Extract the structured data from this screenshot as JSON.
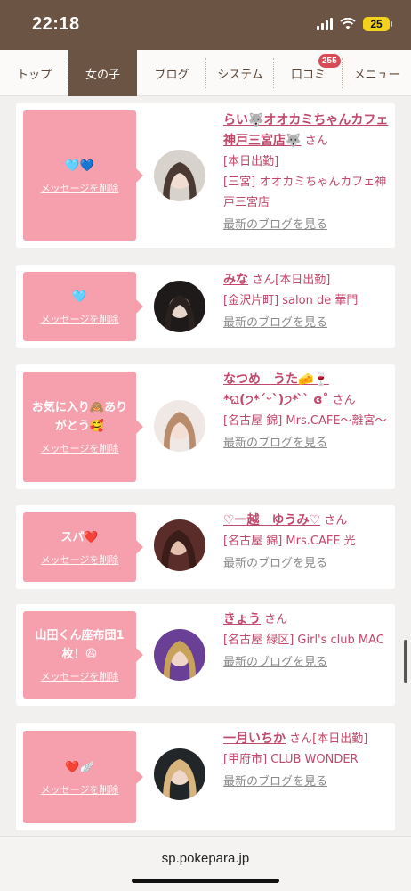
{
  "status": {
    "time": "22:18",
    "battery": "25"
  },
  "nav": {
    "tabs": [
      {
        "label": "トップ",
        "active": false
      },
      {
        "label": "女の子",
        "active": true
      },
      {
        "label": "ブログ",
        "active": false
      },
      {
        "label": "システム",
        "active": false
      },
      {
        "label": "口コミ",
        "active": false,
        "badge": "255"
      },
      {
        "label": "メニュー",
        "active": false
      }
    ]
  },
  "delete_label": "メッセージを削除",
  "blog_label": "最新のブログを見る",
  "suffix": "さん",
  "cards": [
    {
      "message": "🩵💙",
      "name": "らい🐺オオカミちゃんカフェ神戸三宮店🐺",
      "status": "[本日出勤]",
      "shop": "[三宮] オオカミちゃんカフェ神戸三宮店"
    },
    {
      "message": "🩵",
      "name": "みな",
      "status": "[本日出勤]",
      "shop": "[金沢片町] salon de 華門"
    },
    {
      "message": "お気に入り🙈ありがとう🥰",
      "name": "なつめ　うた🧀🍷*ଘ(੭*ˊᵕˋ)੭* ̀ˋ ɞ˚",
      "status": "",
      "shop": "[名古屋 錦] Mrs.CAFE～離宮～"
    },
    {
      "message": "スパ❤️",
      "name": "♡一越　ゆうみ♡",
      "status": "",
      "shop": "[名古屋 錦] Mrs.CAFE 光"
    },
    {
      "message": "山田くん座布団1枚！😆",
      "name": "きょう",
      "status": "",
      "shop": "[名古屋 緑区] Girl's club MAC"
    },
    {
      "message": "❤️🪽",
      "name": "一月いちか",
      "status": "[本日出勤]",
      "shop": "[甲府市] CLUB WONDER"
    }
  ],
  "url": "sp.pokepara.jp",
  "colors": {
    "header": "#6b5443",
    "message_bg": "#f6a0ad",
    "name": "#c0486a",
    "badge": "#d94a57"
  }
}
